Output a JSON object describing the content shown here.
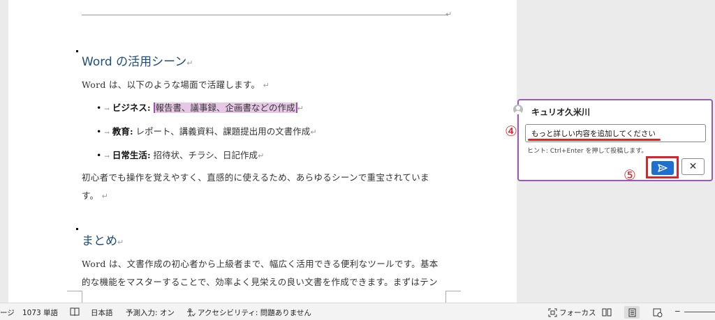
{
  "document": {
    "section1": {
      "heading": "Word の活用シーン",
      "intro": "Word は、以下のような場面で活躍します。",
      "bullets": [
        {
          "label": "ビジネス",
          "sep": ":",
          "text": "報告書、議事録、企画書などの作成"
        },
        {
          "label": "教育",
          "sep": ":",
          "text": "レポート、講義資料、課題提出用の文書作成"
        },
        {
          "label": "日常生活",
          "sep": ":",
          "text": "招待状、チラシ、日記作成"
        }
      ],
      "para_line1": "初心者でも操作を覚えやすく、直感的に使えるため、あらゆるシーンで重宝されていま",
      "para_line2": "す。"
    },
    "section2": {
      "heading": "まとめ",
      "para_line1": "Word は、文書作成の初心者から上級者まで、幅広く活用できる便利なツールです。基本",
      "para_line2": "的な機能をマスターすることで、効率よく見栄えの良い文書を作成できます。まずはテン"
    }
  },
  "comment": {
    "author": "キュリオ久米川",
    "input_value": "もっと詳しい内容を追加してください",
    "hint": "ヒント: Ctrl+Enter を押して投稿します。",
    "step4": "④",
    "step5": "⑤"
  },
  "statusbar": {
    "page_fragment": "ージ",
    "word_count": "1073 単語",
    "language": "日本語",
    "predictive": "予測入力: オン",
    "accessibility": "アクセシビリティ: 問題ありません",
    "focus": "フォーカス",
    "zoom_minus": "−"
  },
  "colors": {
    "heading": "#1f4e79",
    "highlight": "#e6c8e6",
    "card_border": "#9b59b6",
    "annotation_red": "#e0202a",
    "send_button": "#1f6fd1"
  }
}
